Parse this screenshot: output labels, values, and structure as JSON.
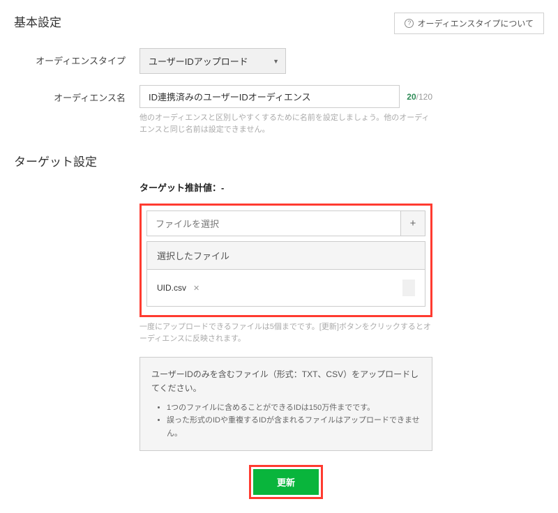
{
  "header": {
    "basic_settings_title": "基本設定",
    "help_button": "オーディエンスタイプについて",
    "help_icon": "?"
  },
  "form": {
    "audience_type_label": "オーディエンスタイプ",
    "audience_type_value": "ユーザーIDアップロード",
    "audience_name_label": "オーディエンス名",
    "audience_name_value": "ID連携済みのユーザーIDオーディエンス",
    "char_count_current": "20",
    "char_count_max": "/120",
    "audience_name_hint": "他のオーディエンスと区別しやすくするために名前を設定しましょう。他のオーディエンスと同じ名前は設定できません。"
  },
  "target": {
    "section_title": "ターゲット設定",
    "estimate_label": "ターゲット推計値：-",
    "file_select_label": "ファイルを選択",
    "add_button": "+",
    "selected_files_header": "選択したファイル",
    "file_name": "UID.csv",
    "file_remove_icon": "✕",
    "upload_hint": "一度にアップロードできるファイルは5個までです。[更新]ボタンをクリックするとオーディエンスに反映されます。"
  },
  "info": {
    "title": "ユーザーIDのみを含むファイル（形式：TXT、CSV）をアップロードしてください。",
    "bullet1": "1つのファイルに含めることができるIDは150万件までです。",
    "bullet2": "誤った形式のIDや重複するIDが含まれるファイルはアップロードできません。"
  },
  "submit": {
    "label": "更新"
  }
}
